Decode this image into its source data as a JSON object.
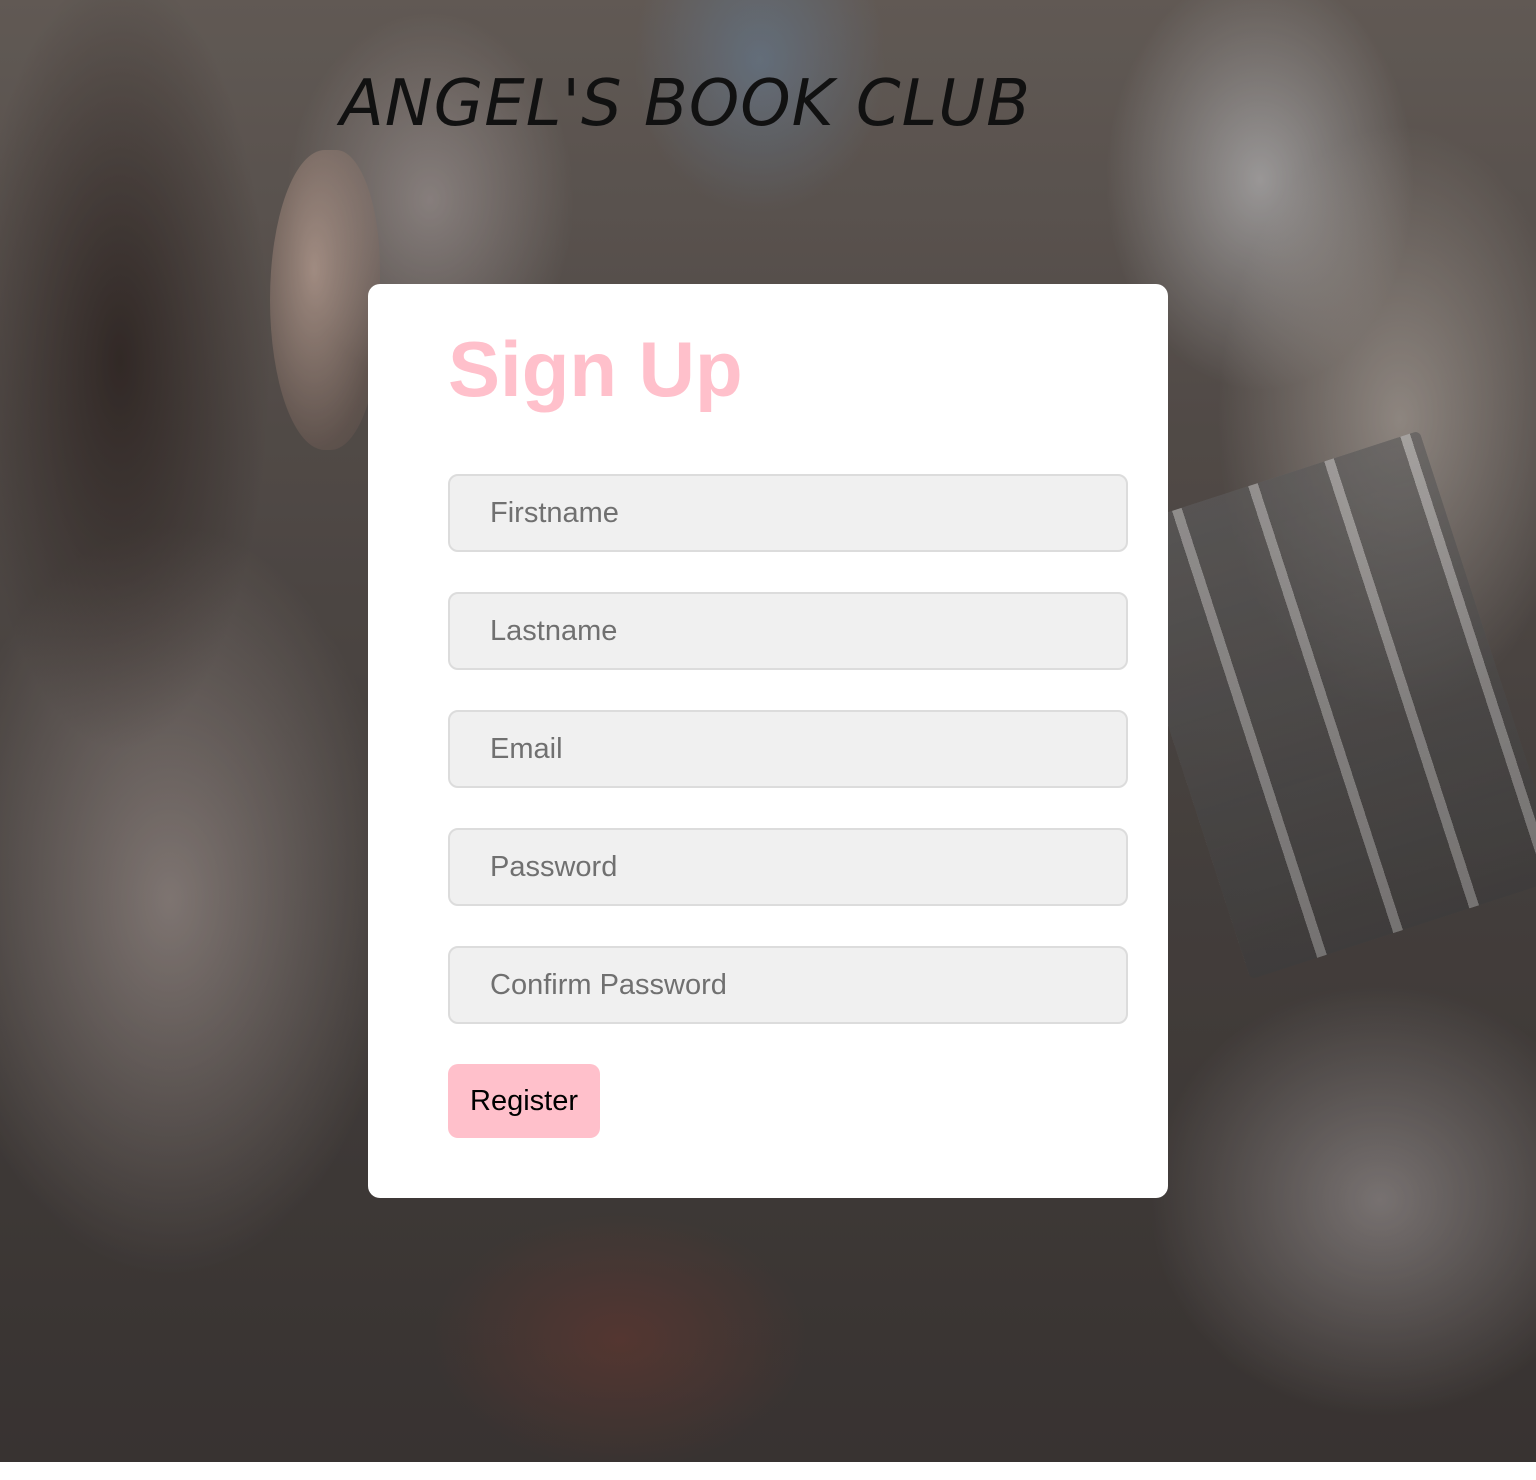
{
  "site": {
    "title": "ANGEL'S BOOK CLUB"
  },
  "signup": {
    "heading": "Sign Up",
    "fields": [
      {
        "placeholder": "Firstname",
        "value": ""
      },
      {
        "placeholder": "Lastname",
        "value": ""
      },
      {
        "placeholder": "Email",
        "value": ""
      },
      {
        "placeholder": "Password",
        "value": ""
      },
      {
        "placeholder": "Confirm Password",
        "value": ""
      }
    ],
    "register_label": "Register"
  },
  "colors": {
    "accent": "#ffc0cb",
    "card_background": "#ffffff",
    "field_background": "#f0f0f0",
    "title_text": "#111111"
  }
}
